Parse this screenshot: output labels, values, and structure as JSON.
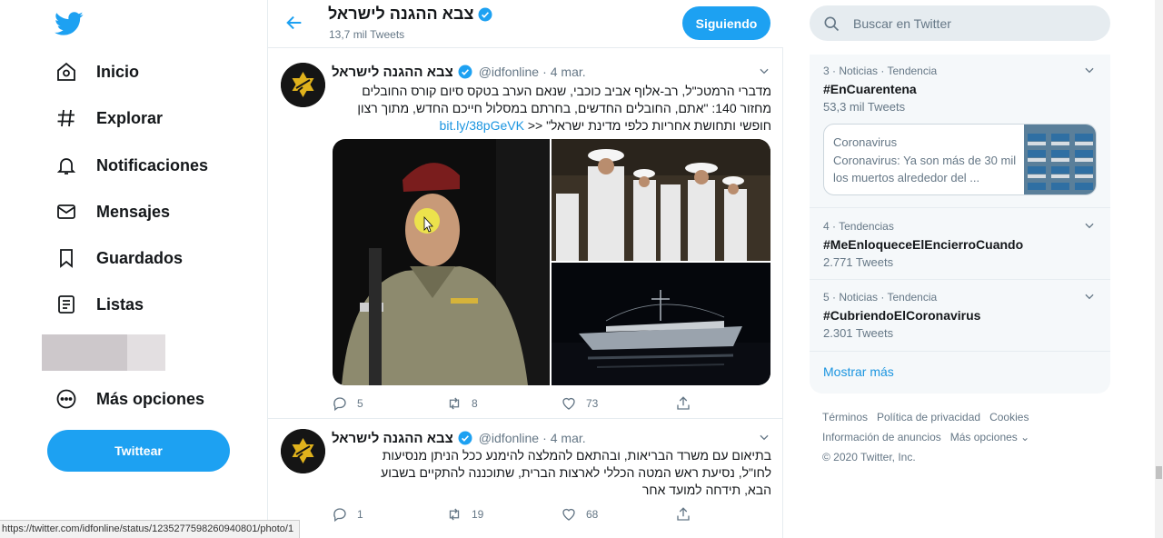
{
  "nav": {
    "items": [
      {
        "label": "Inicio",
        "icon": "home-icon"
      },
      {
        "label": "Explorar",
        "icon": "hashtag-icon"
      },
      {
        "label": "Notificaciones",
        "icon": "bell-icon"
      },
      {
        "label": "Mensajes",
        "icon": "mail-icon"
      },
      {
        "label": "Guardados",
        "icon": "bookmark-icon"
      },
      {
        "label": "Listas",
        "icon": "list-icon"
      },
      {
        "label": "Más opciones",
        "icon": "more-icon"
      }
    ],
    "tweet_button": "Twittear"
  },
  "status_bar": {
    "url": "https://twitter.com/idfonline/status/1235277598260940801/photo/1"
  },
  "header": {
    "title": "צבא ההגנה לישראל",
    "tweet_count": "13,7 mil Tweets",
    "follow_label": "Siguiendo"
  },
  "tweets": [
    {
      "name": "צבא ההגנה לישראל",
      "handle": "@idfonline",
      "time": "4 mar.",
      "lines": [
        "מדברי הרמטכ\"ל, רב-אלוף אביב כוכבי, שנאם הערב בטקס סיום קורס החובלים",
        "מחזור 140: \"אתם, החובלים החדשים, בחרתם במסלול חייכם החדש, מתוך רצון",
        "חופשי ותחושת אחריות כלפי מדינת ישראל\" <<"
      ],
      "link": "bit.ly/38pGeVK",
      "replies": "5",
      "retweets": "8",
      "likes": "73"
    },
    {
      "name": "צבא ההגנה לישראל",
      "handle": "@idfonline",
      "time": "4 mar.",
      "lines": [
        "בתיאום עם משרד הבריאות, ובהתאם להמלצה להימנע ככל הניתן מנסיעות",
        "לחו\"ל, נסיעת ראש המטה הכללי לארצות הברית, שתוכננה להתקיים בשבוע",
        "הבא, תידחה למועד אחר"
      ],
      "replies": "1",
      "retweets": "19",
      "likes": "68"
    }
  ],
  "search": {
    "placeholder": "Buscar en Twitter"
  },
  "trends": [
    {
      "context": "3 · Noticias · Tendencia",
      "tag": "#EnCuarentena",
      "count": "53,3 mil Tweets",
      "news": {
        "category": "Coronavirus",
        "text": "Coronavirus: Ya son más de 30 mil los muertos alrededor del ..."
      }
    },
    {
      "context": "4 · Tendencias",
      "tag": "#MeEnloqueceElEncierroCuando",
      "count": "2.771 Tweets"
    },
    {
      "context": "5 · Noticias · Tendencia",
      "tag": "#CubriendoElCoronavirus",
      "count": "2.301 Tweets"
    }
  ],
  "show_more": "Mostrar más",
  "footer": {
    "row1": [
      "Términos",
      "Política de privacidad",
      "Cookies"
    ],
    "row2": [
      "Información de anuncios",
      "Más opciones ⌄"
    ],
    "copyright": "© 2020 Twitter, Inc."
  },
  "colors": {
    "accent": "#1da1f2",
    "link": "#1b95e0",
    "muted": "#657786"
  }
}
